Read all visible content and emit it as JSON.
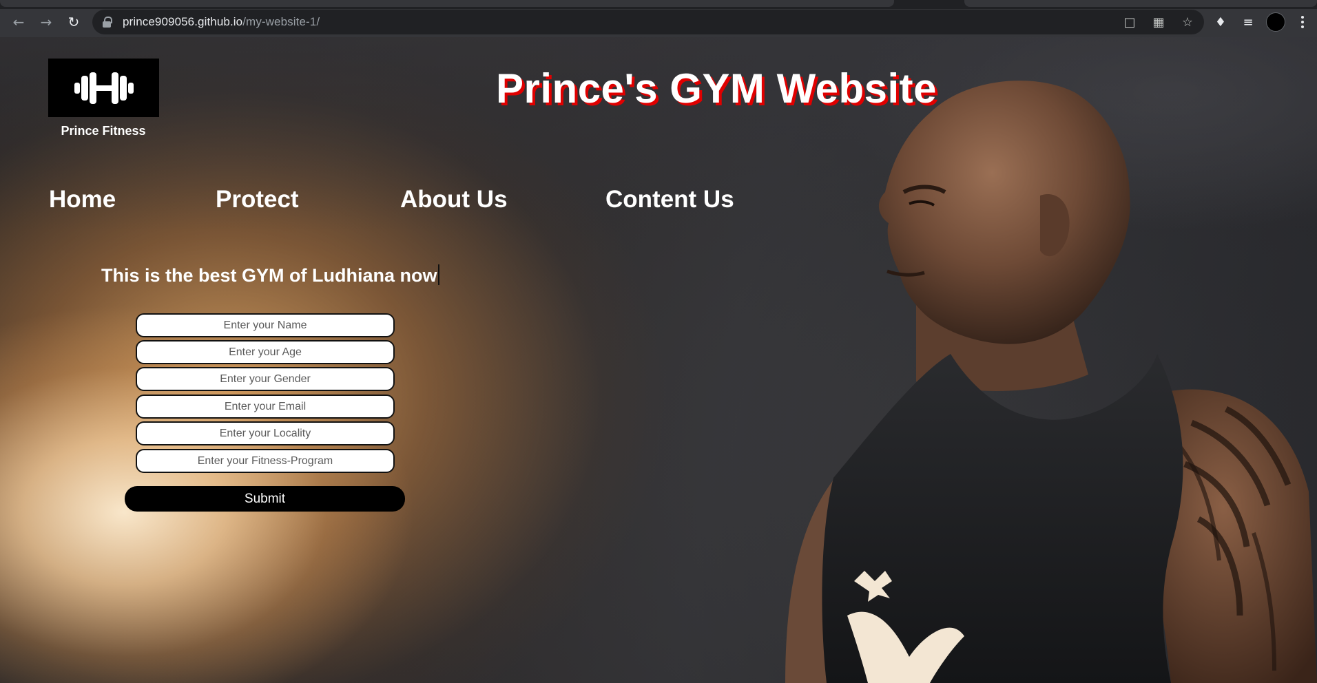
{
  "browser": {
    "url_host": "prince909056.github.io",
    "url_path": "/my-website-1/",
    "icons": [
      "back-arrow",
      "forward-arrow",
      "reload",
      "lock",
      "cast",
      "qr-code",
      "bookmark-star",
      "extensions-puzzle",
      "reading-list",
      "profile-avatar",
      "menu-kebab"
    ]
  },
  "site": {
    "logo_caption": "Prince Fitness",
    "title": "Prince's GYM Website",
    "title_shadow_color": "#e00000",
    "nav": {
      "home": "Home",
      "protect": "Protect",
      "about": "About Us",
      "contact": "Content Us"
    },
    "tagline": "This is the best GYM of Ludhiana now",
    "form": {
      "name_placeholder": "Enter your Name",
      "age_placeholder": "Enter your Age",
      "gender_placeholder": "Enter your Gender",
      "email_placeholder": "Enter your Email",
      "locality_placeholder": "Enter your Locality",
      "program_placeholder": "Enter your Fitness-Program",
      "submit_label": "Submit"
    }
  }
}
